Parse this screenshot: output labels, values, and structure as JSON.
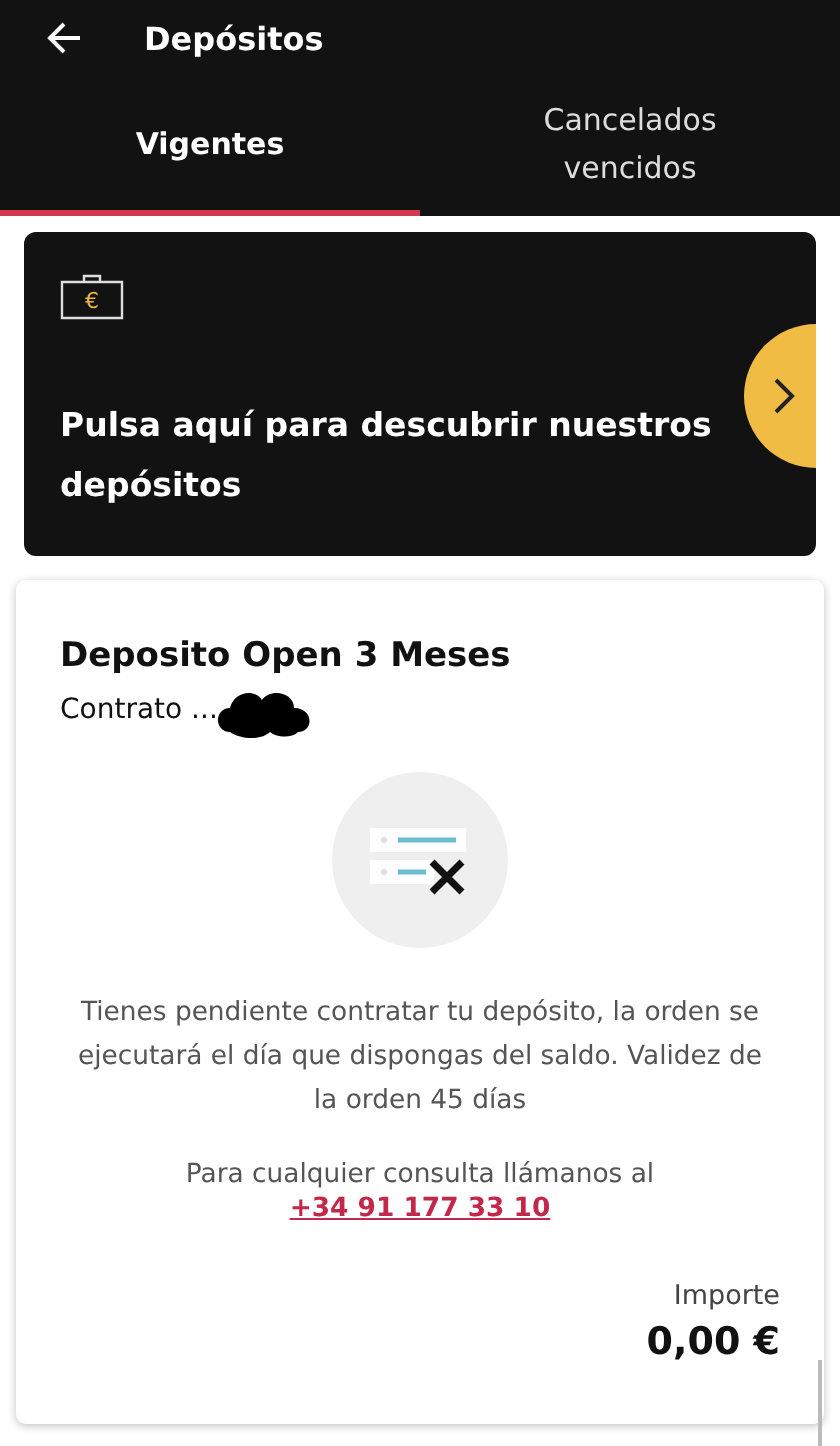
{
  "header": {
    "title": "Depósitos"
  },
  "tabs": [
    {
      "label": "Vigentes",
      "selected": true
    },
    {
      "label": "Cancelados vencidos",
      "selected": false
    }
  ],
  "promo": {
    "icon_symbol": "€",
    "text": "Pulsa aquí para descubrir nuestros depósitos"
  },
  "deposit": {
    "name": "Deposito Open 3 Meses",
    "contract": "Contrato ...",
    "message": "Tienes pendiente contratar tu depósito, la orden se ejecutará el día que dispongas del saldo. Validez de la orden 45 días",
    "contact_text": "Para cualquier consulta llámanos al",
    "phone": "+34 91 177 33 10",
    "amount_label": "Importe",
    "amount": "0,00 €"
  }
}
